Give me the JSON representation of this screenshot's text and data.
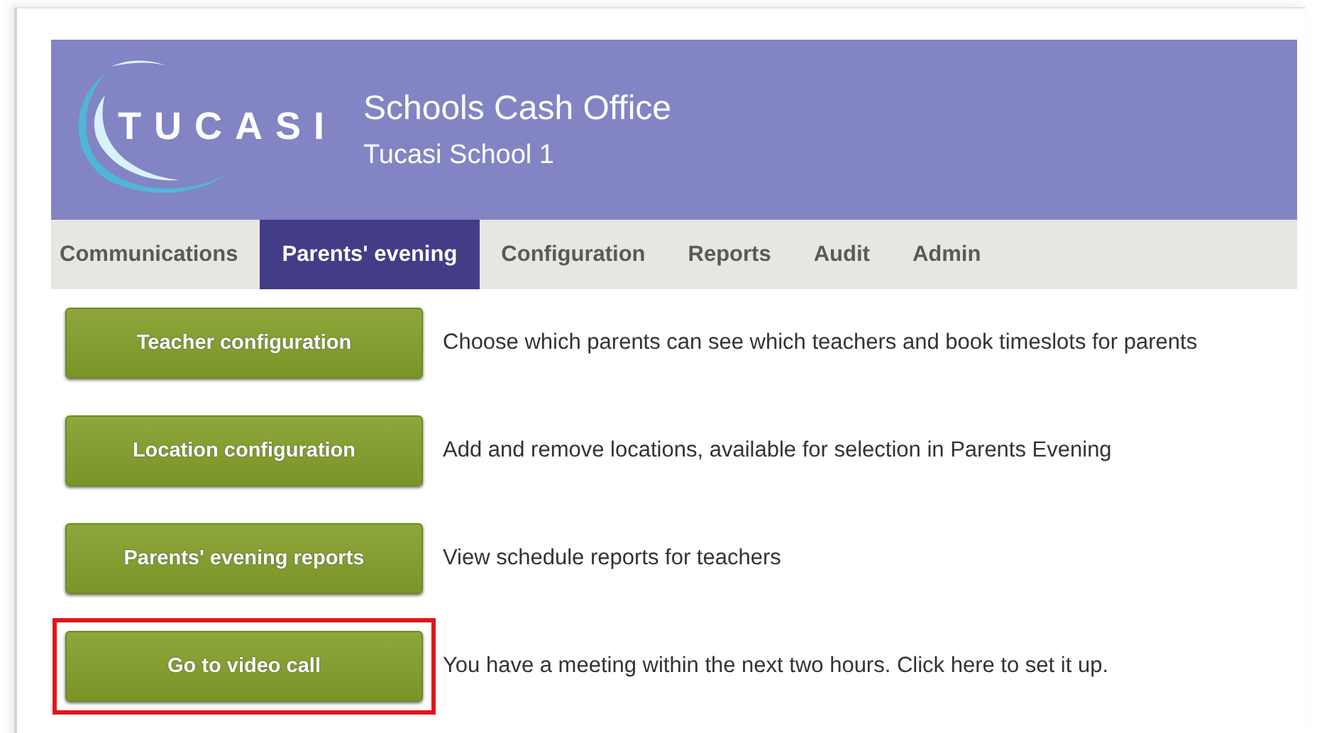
{
  "header": {
    "logo": "TUCASI",
    "title": "Schools Cash Office",
    "subtitle": "Tucasi School 1"
  },
  "tabs": [
    {
      "label": "Communications",
      "selected": false
    },
    {
      "label": "Parents' evening",
      "selected": true
    },
    {
      "label": "Configuration",
      "selected": false
    },
    {
      "label": "Reports",
      "selected": false
    },
    {
      "label": "Audit",
      "selected": false
    },
    {
      "label": "Admin",
      "selected": false
    }
  ],
  "actions": [
    {
      "button": "Teacher configuration",
      "description": "Choose which parents can see which teachers and book timeslots for parents",
      "highlighted": false
    },
    {
      "button": "Location configuration",
      "description": "Add and remove locations, available for selection in Parents Evening",
      "highlighted": false
    },
    {
      "button": "Parents' evening reports",
      "description": "View schedule reports for teachers",
      "highlighted": false
    },
    {
      "button": "Go to video call",
      "description": "You have a meeting within the next two hours. Click here to set it up.",
      "highlighted": true
    }
  ]
}
